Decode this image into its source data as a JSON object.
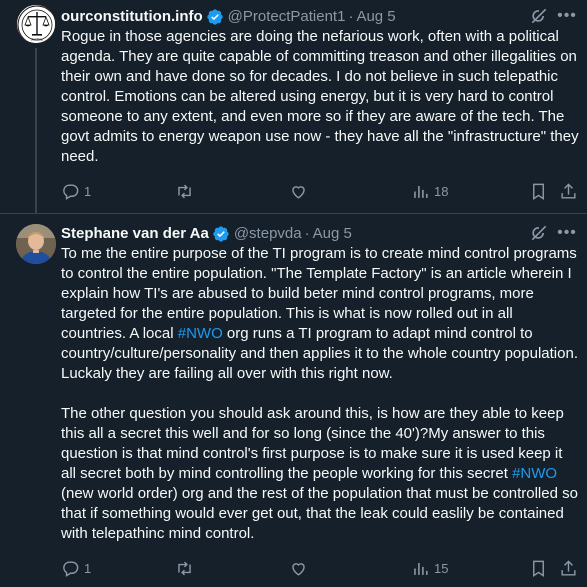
{
  "tweets": [
    {
      "display_name": "ourconstitution.info",
      "handle": "@ProtectPatient1",
      "separator": "·",
      "date": "Aug 5",
      "avatar_text": "Justice",
      "body": "Rogue in those agencies are doing the nefarious work, often with a political agenda. They are quite capable of committing treason and other illegalities on their own and have done so for decades. I do not believe in such telepathic control. Emotions can be altered using energy, but it is very hard to control someone to any extent, and even more so if they are aware of the tech. The govt admits to energy weapon use now - they have all the \"infrastructure\" they need.",
      "reply_count": "1",
      "views_count": "18"
    },
    {
      "display_name": "Stephane van der Aa",
      "handle": "@stepvda",
      "separator": "·",
      "date": "Aug 5",
      "body_part1": "To me the entire purpose of the TI program is to create mind control programs to control the entire population. \"The Template Factory\" is an article wherein I explain how TI's are abused to build beter mind control programs, more targeted for the entire population. This is what is now rolled out in all countries. A local ",
      "hashtag1": "#NWO",
      "body_part2": " org runs a TI program to adapt mind control to country/culture/personality and then applies it to the whole country population. Luckaly they are failing all over with this right now.\n\nThe other question you should ask around this, is how are they able to keep this all a secret this well and for so long (since the 40')?My answer to this question is that mind control's first purpose is to make sure it is used keep it all secret both by mind controlling the people working for this secret ",
      "hashtag2": "#NWO",
      "body_part3": " (new world order) org and the rest of the population that must be controlled so that if something would ever get out, that the leak could easlily be contained with telepathinc mind control.",
      "reply_count": "1",
      "views_count": "15"
    }
  ],
  "icons": {
    "verified": "verified-badge-icon",
    "grok": "grok-icon",
    "more": "more-icon",
    "reply": "reply-icon",
    "retweet": "retweet-icon",
    "like": "like-icon",
    "views": "views-icon",
    "bookmark": "bookmark-icon",
    "share": "share-icon"
  },
  "colors": {
    "background": "#15202b",
    "text": "#f7f9f9",
    "secondary": "#8b98a5",
    "accent": "#1d9bf0",
    "divider": "#38444d"
  }
}
